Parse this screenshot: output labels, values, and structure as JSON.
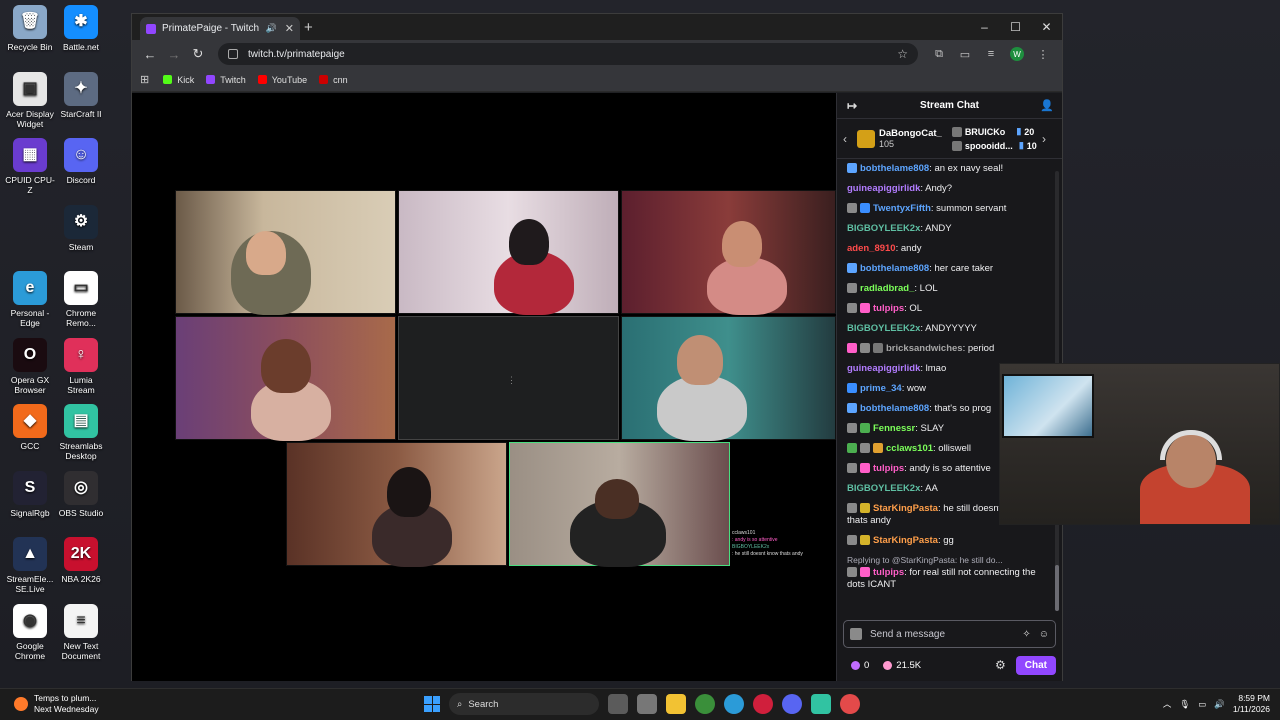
{
  "desktop": {
    "icons": [
      {
        "label": "Recycle Bin",
        "color": "#8aa8c8",
        "glyph": "🗑"
      },
      {
        "label": "Battle.net",
        "color": "#148eff",
        "glyph": "✱"
      },
      {
        "label": "Acer Display Widget",
        "color": "#e6e6e6",
        "glyph": "▣"
      },
      {
        "label": "StarCraft II",
        "color": "#5d6b82",
        "glyph": "✦"
      },
      {
        "label": "CPUID CPU-Z",
        "color": "#6a3ccf",
        "glyph": "▦"
      },
      {
        "label": "Discord",
        "color": "#5865f2",
        "glyph": "☺"
      },
      {
        "label": "Steam",
        "color": "#1b2838",
        "glyph": "⚙"
      },
      {
        "label": "Personal - Edge",
        "color": "#2b9bd8",
        "glyph": "e"
      },
      {
        "label": "Chrome Remo...",
        "color": "#ffffff",
        "glyph": "▭"
      },
      {
        "label": "Opera GX Browser",
        "color": "#1a0b10",
        "glyph": "O"
      },
      {
        "label": "Lumia Stream",
        "color": "#e0305a",
        "glyph": "♀"
      },
      {
        "label": "GCC",
        "color": "#f26a1b",
        "glyph": "◆"
      },
      {
        "label": "Streamlabs Desktop",
        "color": "#31c3a2",
        "glyph": "▤"
      },
      {
        "label": "SignalRgb",
        "color": "#222233",
        "glyph": "S"
      },
      {
        "label": "OBS Studio",
        "color": "#302e31",
        "glyph": "◎"
      },
      {
        "label": "StreamEle... SE.Live",
        "color": "#223355",
        "glyph": "▲"
      },
      {
        "label": "NBA 2K26",
        "color": "#c8102e",
        "glyph": "2K"
      },
      {
        "label": "Google Chrome",
        "color": "#ffffff",
        "glyph": "◉"
      },
      {
        "label": "New Text Document",
        "color": "#f4f4f4",
        "glyph": "≡"
      }
    ]
  },
  "browser": {
    "tab_title": "PrimatePaige - Twitch",
    "url": "twitch.tv/primatepaige",
    "profile_initial": "W",
    "bookmarks": [
      {
        "label": "Kick",
        "color": "#53fc18"
      },
      {
        "label": "Twitch",
        "color": "#9146ff"
      },
      {
        "label": "YouTube",
        "color": "#ff0000"
      },
      {
        "label": "cnn",
        "color": "#cc0000"
      }
    ]
  },
  "chat": {
    "title": "Stream Chat",
    "top_gifter": {
      "name": "DaBongoCat_",
      "count": "105"
    },
    "gifters": [
      {
        "name": "BRUICKo",
        "count": "20"
      },
      {
        "name": "spoooidd...",
        "count": "10"
      }
    ],
    "messages": [
      {
        "user": "bobthelame808",
        "color": "#5da5ff",
        "text": ": an ex navy seal!",
        "badges": [
          "#5da5ff"
        ]
      },
      {
        "user": "guineapiggirlidk",
        "color": "#b27cff",
        "text": ": Andy?",
        "badges": []
      },
      {
        "user": "TwentyxFifth",
        "color": "#5da5ff",
        "text": ": summon servant",
        "badges": [
          "#8a8a8a",
          "#3a8eff"
        ]
      },
      {
        "user": "BIGBOYLEEK2x",
        "color": "#5fbfa3",
        "text": ": ANDY",
        "badges": []
      },
      {
        "user": "aden_8910",
        "color": "#ff4b4b",
        "text": ": andy",
        "badges": []
      },
      {
        "user": "bobthelame808",
        "color": "#5da5ff",
        "text": ": her care taker",
        "badges": [
          "#5da5ff"
        ]
      },
      {
        "user": "radladbrad_",
        "color": "#7cff5a",
        "text": ": LOL",
        "badges": [
          "#8a8a8a"
        ]
      },
      {
        "user": "tulpips",
        "color": "#ff5ec8",
        "text": ": OL",
        "badges": [
          "#8a8a8a",
          "#ff5ec8"
        ]
      },
      {
        "user": "BIGBOYLEEK2x",
        "color": "#5fbfa3",
        "text": ": ANDYYYYY",
        "badges": []
      },
      {
        "user": "bricksandwiches",
        "color": "#a7a7a7",
        "text": ": period",
        "badges": [
          "#ff5ec8",
          "#8a8a8a",
          "#777777"
        ]
      },
      {
        "user": "guineapiggirlidk",
        "color": "#b27cff",
        "text": ": lmao",
        "badges": []
      },
      {
        "user": "prime_34",
        "color": "#5da5ff",
        "text": ": wow",
        "badges": [
          "#3a8eff"
        ]
      },
      {
        "user": "bobthelame808",
        "color": "#5da5ff",
        "text": ": that's so prog",
        "badges": [
          "#5da5ff"
        ]
      },
      {
        "user": "Fennessr",
        "color": "#7cff5a",
        "text": ": SLAY",
        "badges": [
          "#8a8a8a",
          "#4caf50"
        ]
      },
      {
        "user": "cclaws101",
        "color": "#7cff5a",
        "text": ": olliswell",
        "badges": [
          "#4caf50",
          "#8a8a8a",
          "#e0a030"
        ]
      },
      {
        "user": "tulpips",
        "color": "#ff5ec8",
        "text": ": andy is so attentive",
        "badges": [
          "#8a8a8a",
          "#ff5ec8"
        ]
      },
      {
        "user": "BIGBOYLEEK2x",
        "color": "#5fbfa3",
        "text": ": AA",
        "badges": []
      },
      {
        "user": "StarKingPasta",
        "color": "#ff9f4a",
        "text": ": he still doesnt know thats andy",
        "badges": [
          "#8a8a8a",
          "#d4b32a"
        ]
      },
      {
        "user": "StarKingPasta",
        "color": "#ff9f4a",
        "text": ": gg",
        "badges": [
          "#8a8a8a",
          "#d4b32a"
        ]
      }
    ],
    "reply_line": "Replying to @StarKingPasta: he still do...",
    "last_message": {
      "user": "tulpips",
      "color": "#ff5ec8",
      "text": ": for real still not connecting the dots ICANT"
    },
    "input_placeholder": "Send a message",
    "points_a": "0",
    "points_b": "21.5K",
    "chat_button": "Chat"
  },
  "taskbar": {
    "weather_title": "Temps to plum...",
    "weather_sub": "Next Wednesday",
    "search_placeholder": "Search",
    "time": "8:59 PM",
    "date": "1/11/2026"
  }
}
